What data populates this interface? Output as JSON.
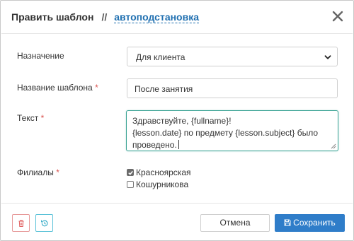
{
  "header": {
    "title": "Править шаблон",
    "separator": "//",
    "link": "автоподстановка"
  },
  "form": {
    "purpose": {
      "label": "Назначение",
      "selected": "Для клиента"
    },
    "name": {
      "label": "Название шаблона",
      "required_mark": "*",
      "value": "После занятия"
    },
    "text": {
      "label": "Текст",
      "required_mark": "*",
      "line1": "Здравствуйте, {fullname}!",
      "line2": "{lesson.date} по предмету {lesson.subject} было",
      "line3": "проведено."
    },
    "branches": {
      "label": "Филиалы",
      "required_mark": "*",
      "options": [
        {
          "label": "Красноярская",
          "checked": true
        },
        {
          "label": "Кошурникова",
          "checked": false
        }
      ]
    }
  },
  "footer": {
    "delete_icon": "trash-icon",
    "history_icon": "history-icon",
    "cancel_label": "Отмена",
    "save_icon": "floppy-disk-icon",
    "save_label": "Сохранить"
  },
  "colors": {
    "link": "#1f6fb0",
    "required": "#d9534f",
    "focus_border": "#3aa394",
    "save_button": "#2f7dc9",
    "delete_border": "#e79a9a",
    "history_border": "#5bc2d8"
  }
}
